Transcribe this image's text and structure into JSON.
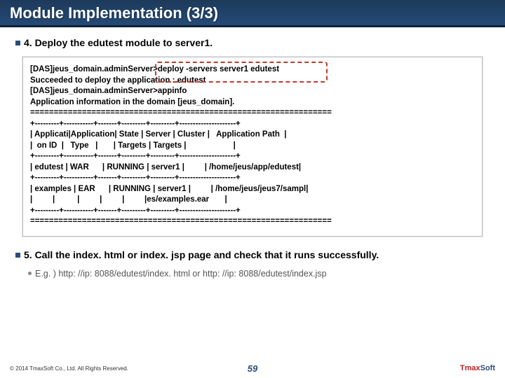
{
  "title": "Module Implementation (3/3)",
  "step4": "4. Deploy the edutest module to server1.",
  "console": "[DAS]jeus_domain.adminServer>deploy -servers server1 edutest\nSucceeded to deploy the application : edutest\n[DAS]jeus_domain.adminServer>appinfo\nApplication information in the domain [jeus_domain].\n================================================================\n+---------+-----------+-------+---------+---------+---------------------+\n| Applicati|Application| State | Server | Cluster |   Application Path  |\n|  on ID  |   Type   |       | Targets | Targets |                     |\n+---------+-----------+-------+---------+---------+---------------------+\n| edutest | WAR      | RUNNING | server1 |         | /home/jeus/app/edutest|\n+---------+-----------+-------+---------+---------+---------------------+\n| examples | EAR      | RUNNING | server1 |         | /home/jeus/jeus7/sampl|\n|         |          |         |         |         |es/examples.ear       |\n+---------+-----------+-------+---------+---------+---------------------+\n================================================================",
  "step5": "5. Call the index. html or index. jsp page and check that it runs successfully.",
  "step5_sub": "E.g. ) http: //ip: 8088/edutest/index. html or http: //ip: 8088/edutest/index.jsp",
  "copyright": "© 2014 TmaxSoft Co., Ltd. All Rights Reserved.",
  "pagenum": "59",
  "logo": {
    "tmax": "Tmax",
    "soft": "Soft"
  }
}
